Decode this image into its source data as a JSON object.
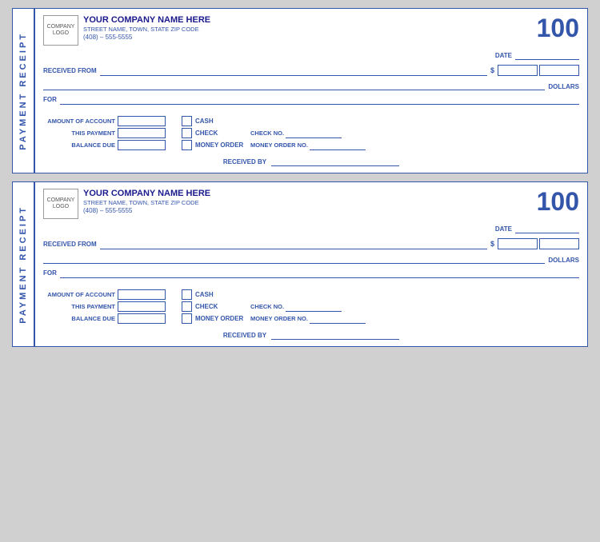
{
  "receipt1": {
    "side_label": "PAYMENT RECEIPT",
    "receipt_number": "100",
    "company_logo_line1": "COMPANY",
    "company_logo_line2": "LOGO",
    "company_name": "YOUR COMPANY NAME HERE",
    "company_address": "STREET NAME, TOWN, STATE  ZIP CODE",
    "company_phone": "(408) – 555-5555",
    "date_label": "DATE",
    "received_from_label": "RECEIVED FROM",
    "dollar_sign": "$",
    "dollars_label": "DOLLARS",
    "for_label": "FOR",
    "amount_of_account_label": "AMOUNT OF ACCOUNT",
    "this_payment_label": "THIS PAYMENT",
    "balance_due_label": "BALANCE DUE",
    "cash_label": "CASH",
    "check_label": "CHECK",
    "money_order_label": "MONEY ORDER",
    "check_no_label": "CHECK NO.",
    "money_order_no_label": "MONEY ORDER NO.",
    "received_by_label": "RECEIVED BY"
  },
  "receipt2": {
    "side_label": "PAYMENT RECEIPT",
    "receipt_number": "100",
    "company_logo_line1": "COMPANY",
    "company_logo_line2": "LOGO",
    "company_name": "YOUR COMPANY NAME HERE",
    "company_address": "STREET NAME, TOWN, STATE  ZIP CODE",
    "company_phone": "(408) – 555-5555",
    "date_label": "DATE",
    "received_from_label": "RECEIVED FROM",
    "dollar_sign": "$",
    "dollars_label": "DOLLARS",
    "for_label": "FOR",
    "amount_of_account_label": "AMOUNT OF ACCOUNT",
    "this_payment_label": "THIS PAYMENT",
    "balance_due_label": "BALANCE DUE",
    "cash_label": "CASH",
    "check_label": "CHECK",
    "money_order_label": "MONEY ORDER",
    "check_no_label": "CHECK NO.",
    "money_order_no_label": "MONEY ORDER NO.",
    "received_by_label": "RECEIVED BY"
  }
}
